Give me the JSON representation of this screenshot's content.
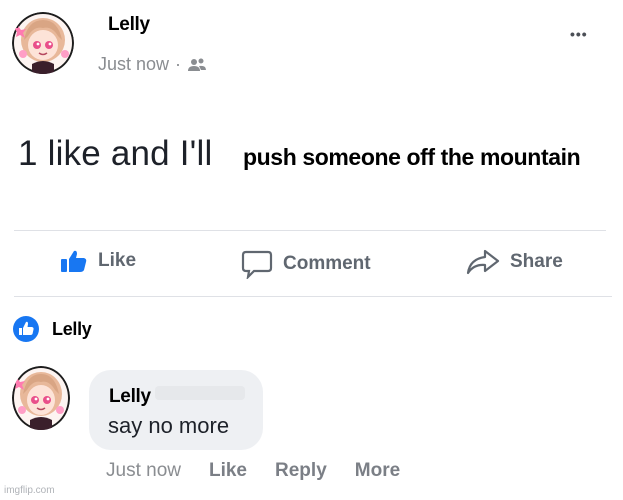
{
  "post": {
    "author": "Lelly",
    "timestamp": "Just now",
    "privacy_separator": "·",
    "more_options": "•••",
    "text_prefix": "1 like and I'll",
    "text_overlay": "push someone off the mountain"
  },
  "actions": {
    "like": "Like",
    "comment": "Comment",
    "share": "Share"
  },
  "likes": {
    "liker_name": "Lelly"
  },
  "comment": {
    "author": "Lelly",
    "text": "say no more",
    "timestamp": "Just now",
    "like_label": "Like",
    "reply_label": "Reply",
    "more_label": "More"
  },
  "watermark": "imgflip.com",
  "colors": {
    "like_blue": "#1877f2",
    "meta_gray": "#8a8d91",
    "action_gray": "#606770",
    "bubble_bg": "#eef0f3",
    "avatar_hair": "#e8b89a",
    "avatar_accent": "#e94f8a"
  }
}
